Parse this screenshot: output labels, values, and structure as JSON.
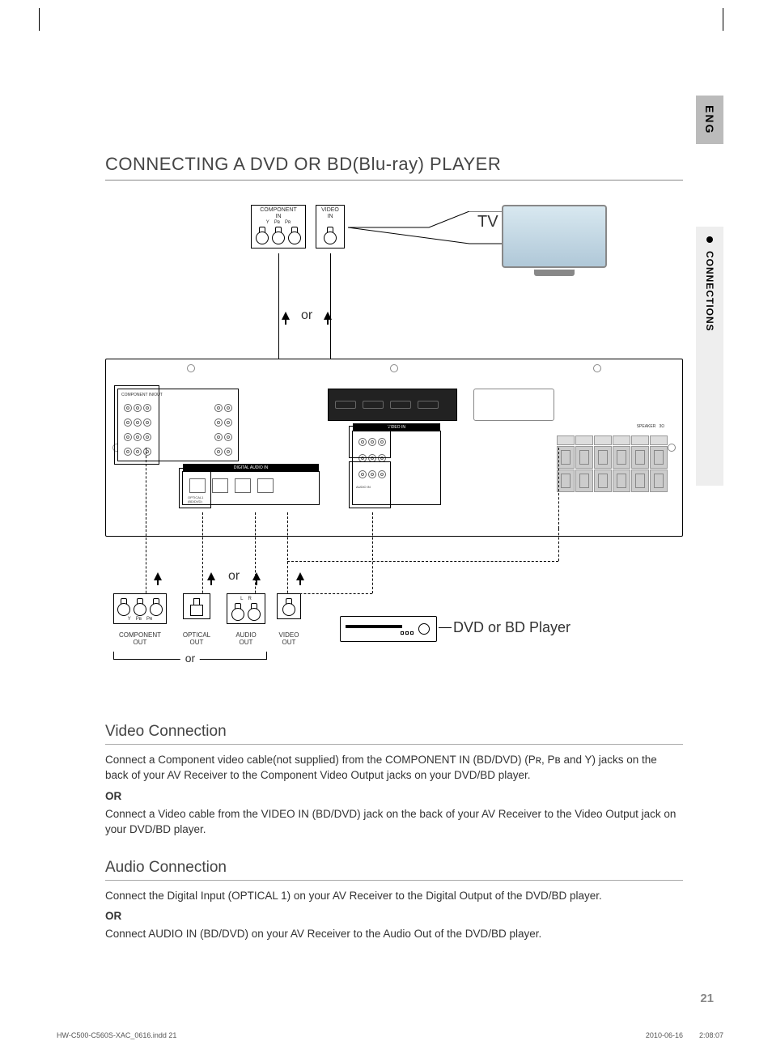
{
  "lang_tab": "ENG",
  "section_tab": "CONNECTIONS",
  "main_title": "CONNECTING A DVD OR BD(Blu-ray) PLAYER",
  "diagram": {
    "tv_label": "TV",
    "component_in": {
      "title1": "COMPONENT",
      "title2": "IN",
      "y": "Y",
      "pb": "Pʙ",
      "pr": "Pʀ"
    },
    "video_in": {
      "title1": "VIDEO",
      "title2": "IN"
    },
    "or": "or",
    "player_label": "DVD or BD Player",
    "outputs": {
      "component": {
        "label1": "COMPONENT",
        "label2": "OUT",
        "y": "Y",
        "pb": "Pʙ",
        "pr": "Pʀ"
      },
      "optical": {
        "label1": "OPTICAL",
        "label2": "OUT"
      },
      "audio": {
        "label1": "AUDIO",
        "label2": "OUT",
        "l": "L",
        "r": "R"
      },
      "video": {
        "label1": "VIDEO",
        "label2": "OUT"
      }
    }
  },
  "video_section": {
    "heading": "Video Connection",
    "p1": "Connect a Component video cable(not supplied) from the COMPONENT IN (BD/DVD) (Pʀ, Pʙ and Y) jacks on the back of your AV Receiver to the Component Video Output jacks on your DVD/BD player.",
    "or": "OR",
    "p2": "Connect a Video cable from the VIDEO IN (BD/DVD) jack on the back of your AV Receiver to the Video Output jack on your DVD/BD player."
  },
  "audio_section": {
    "heading": "Audio Connection",
    "p1": "Connect the Digital Input (OPTICAL 1) on your AV Receiver to the Digital Output of the DVD/BD player.",
    "or": "OR",
    "p2": "Connect AUDIO IN (BD/DVD) on your AV Receiver to the Audio Out of the DVD/BD player."
  },
  "page_number": "21",
  "footer": {
    "file": "HW-C500-C560S-XAC_0616.indd   21",
    "date": "2010-06-16",
    "time": "2:08:07"
  }
}
